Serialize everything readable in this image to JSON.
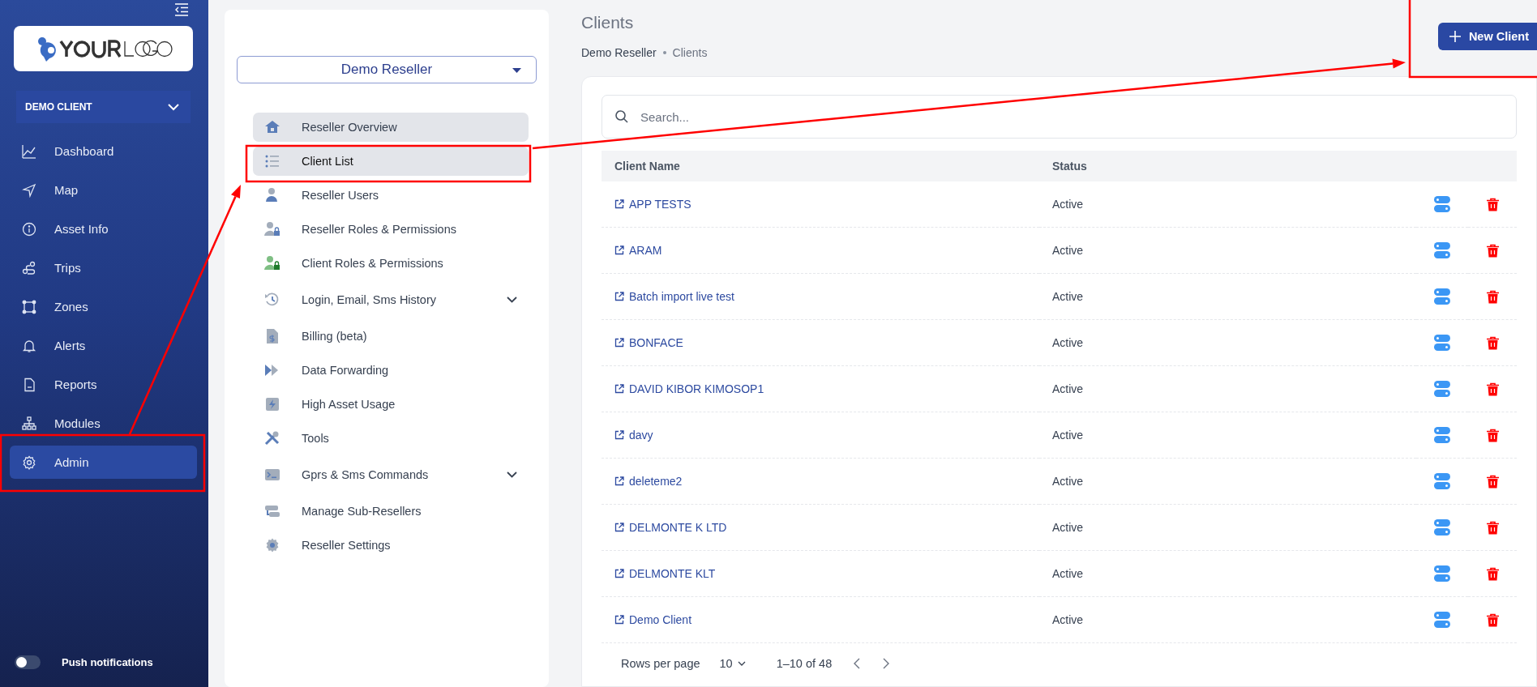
{
  "sidebar": {
    "client_selector": "DEMO CLIENT",
    "nav_items": [
      {
        "label": "Dashboard",
        "selected": false
      },
      {
        "label": "Map",
        "selected": false
      },
      {
        "label": "Asset Info",
        "selected": false
      },
      {
        "label": "Trips",
        "selected": false
      },
      {
        "label": "Zones",
        "selected": false
      },
      {
        "label": "Alerts",
        "selected": false
      },
      {
        "label": "Reports",
        "selected": false
      },
      {
        "label": "Modules",
        "selected": false
      },
      {
        "label": "Admin",
        "selected": true
      }
    ],
    "push_notifications": {
      "label": "Push notifications",
      "on": false
    }
  },
  "reseller_panel": {
    "selector": "Demo Reseller",
    "items": [
      {
        "label": "Reseller Overview",
        "selected": true,
        "expandable": false
      },
      {
        "label": "Client List",
        "selected": true,
        "expandable": false
      },
      {
        "label": "Reseller Users",
        "selected": false,
        "expandable": false
      },
      {
        "label": "Reseller Roles & Permissions",
        "selected": false,
        "expandable": false
      },
      {
        "label": "Client Roles & Permissions",
        "selected": false,
        "expandable": false
      },
      {
        "label": "Login, Email, Sms History",
        "selected": false,
        "expandable": true
      },
      {
        "label": "Billing (beta)",
        "selected": false,
        "expandable": false
      },
      {
        "label": "Data Forwarding",
        "selected": false,
        "expandable": false
      },
      {
        "label": "High Asset Usage",
        "selected": false,
        "expandable": false
      },
      {
        "label": "Tools",
        "selected": false,
        "expandable": false
      },
      {
        "label": "Gprs & Sms Commands",
        "selected": false,
        "expandable": true
      },
      {
        "label": "Manage Sub-Resellers",
        "selected": false,
        "expandable": false
      },
      {
        "label": "Reseller Settings",
        "selected": false,
        "expandable": false
      }
    ]
  },
  "main": {
    "title": "Clients",
    "breadcrumb": [
      "Demo Reseller",
      "Clients"
    ],
    "new_button": "New Client",
    "search": {
      "placeholder": "Search..."
    },
    "table": {
      "columns": [
        "Client Name",
        "Status"
      ],
      "rows": [
        {
          "name": "APP TESTS",
          "status": "Active"
        },
        {
          "name": "ARAM",
          "status": "Active"
        },
        {
          "name": "Batch import live test",
          "status": "Active"
        },
        {
          "name": "BONFACE",
          "status": "Active"
        },
        {
          "name": "DAVID KIBOR KIMOSOP1",
          "status": "Active"
        },
        {
          "name": "davy",
          "status": "Active"
        },
        {
          "name": "deleteme2",
          "status": "Active"
        },
        {
          "name": "DELMONTE K LTD",
          "status": "Active"
        },
        {
          "name": "DELMONTE KLT",
          "status": "Active"
        },
        {
          "name": "Demo Client",
          "status": "Active"
        }
      ]
    },
    "pagination": {
      "rows_per_page_label": "Rows per page",
      "rows_per_page": "10",
      "range": "1–10 of 48"
    }
  },
  "annotations": [
    {
      "kind": "frame"
    },
    {
      "kind": "frame"
    },
    {
      "kind": "frame"
    },
    {
      "kind": "arrow"
    },
    {
      "kind": "arrow"
    }
  ]
}
